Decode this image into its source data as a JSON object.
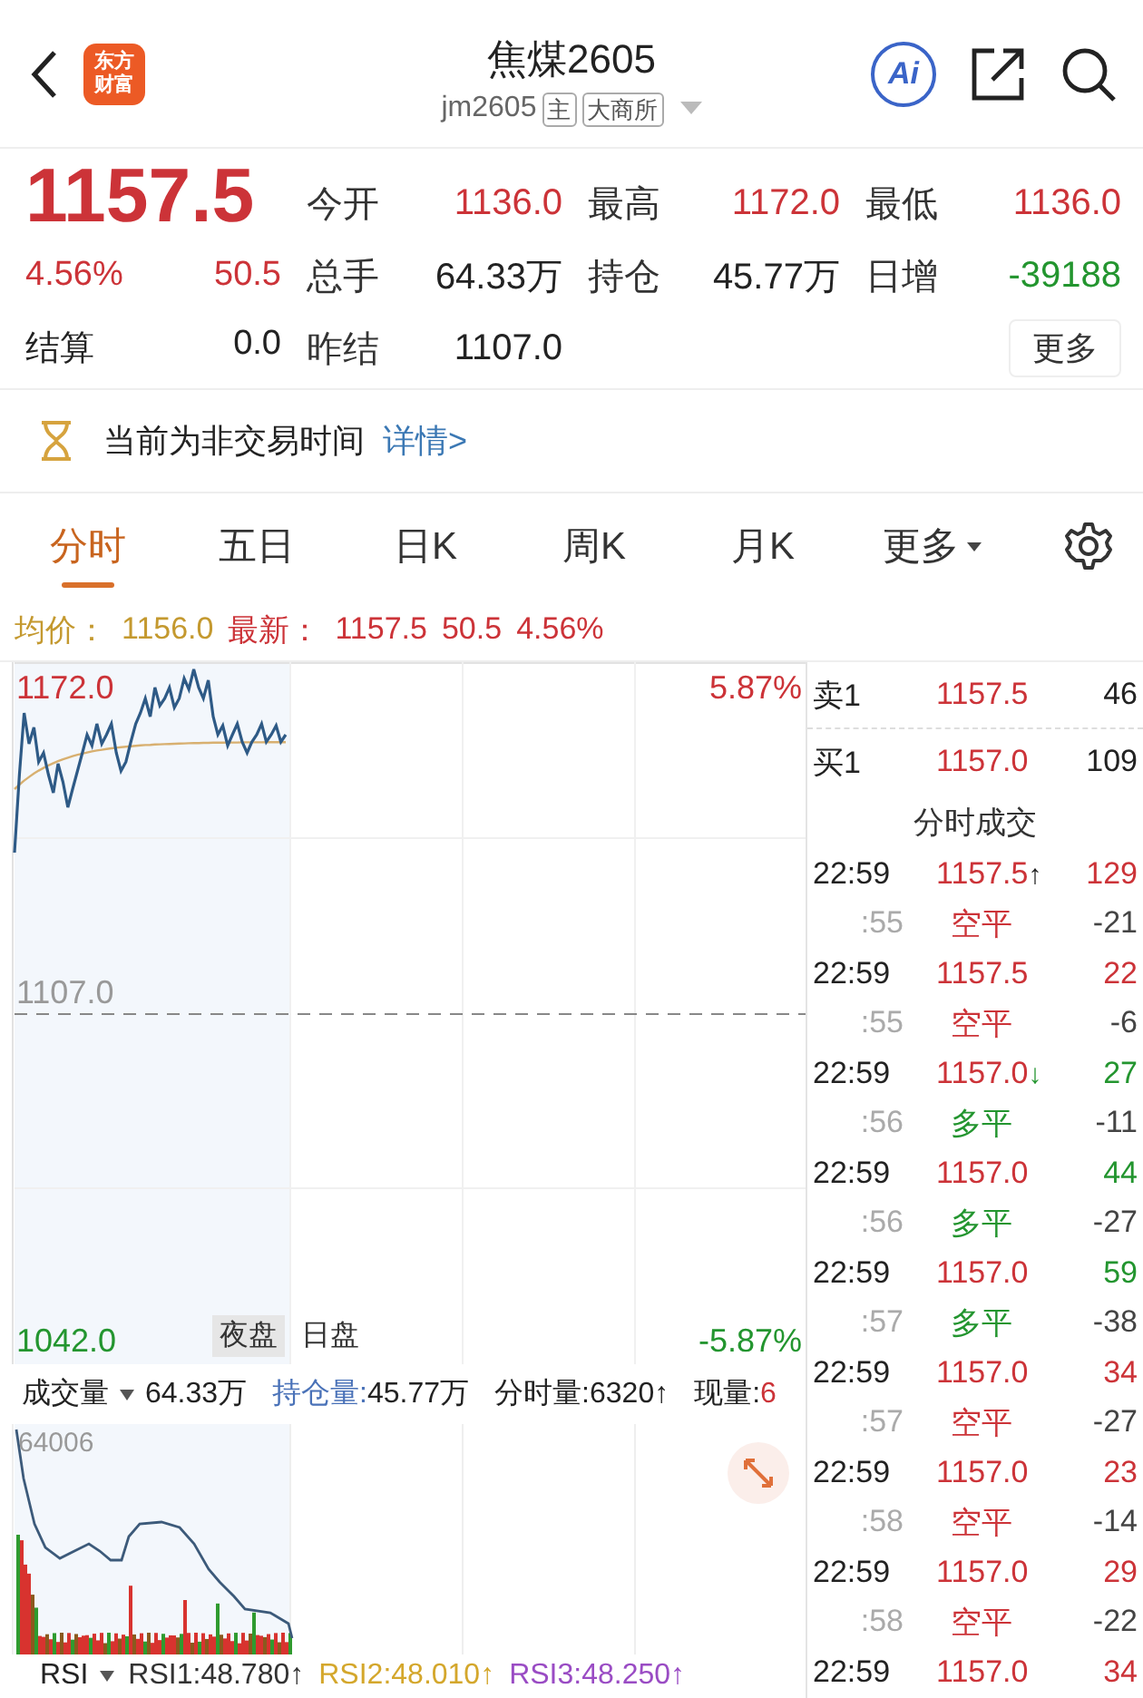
{
  "header": {
    "logo_lines": [
      "东方",
      "财富"
    ],
    "title": "焦煤2605",
    "code": "jm2605",
    "badges": [
      "主",
      "大商所"
    ],
    "ai_label": "Ai"
  },
  "quote": {
    "price": "1157.5",
    "change_percent": "4.56%",
    "change": "50.5",
    "color": "#cc3338",
    "settle_label": "结算",
    "settle_value": "0.0",
    "more_button": "更多",
    "fields": [
      {
        "label": "今开",
        "value": "1136.0",
        "color": "#cc3338"
      },
      {
        "label": "最高",
        "value": "1172.0",
        "color": "#cc3338"
      },
      {
        "label": "最低",
        "value": "1136.0",
        "color": "#cc3338"
      },
      {
        "label": "总手",
        "value": "64.33万",
        "color": "#222222"
      },
      {
        "label": "持仓",
        "value": "45.77万",
        "color": "#222222"
      },
      {
        "label": "日增",
        "value": "-39188",
        "color": "#23952f"
      },
      {
        "label": "昨结",
        "value": "1107.0",
        "color": "#222222"
      }
    ]
  },
  "notice": {
    "text": "当前为非交易时间",
    "link": "详情>"
  },
  "tabs": [
    {
      "label": "分时",
      "selected": true,
      "dropdown": false
    },
    {
      "label": "五日",
      "selected": false,
      "dropdown": false
    },
    {
      "label": "日K",
      "selected": false,
      "dropdown": false
    },
    {
      "label": "周K",
      "selected": false,
      "dropdown": false
    },
    {
      "label": "月K",
      "selected": false,
      "dropdown": false
    },
    {
      "label": "更多",
      "selected": false,
      "dropdown": true
    }
  ],
  "summary": [
    {
      "label": "均价：",
      "value": "1156.0",
      "color": "#c4992f"
    },
    {
      "label": "最新：",
      "value": "1157.5",
      "color": "#cc3338"
    },
    {
      "value": "50.5",
      "color": "#cc3338"
    },
    {
      "value": "4.56%",
      "color": "#cc3338"
    }
  ],
  "price_chart": {
    "top_price": "1172.0",
    "top_percent": "5.87%",
    "base_price": "1107.0",
    "bottom_price": "1042.0",
    "bottom_percent": "-5.87%",
    "sessions": [
      {
        "label": "夜盘",
        "selected": true
      },
      {
        "label": "日盘",
        "selected": false
      }
    ]
  },
  "order_book": [
    {
      "label": "卖1",
      "price": "1157.5",
      "volume": "46"
    },
    {
      "label": "买1",
      "price": "1157.0",
      "volume": "109"
    }
  ],
  "trades_title": "分时成交",
  "trades": [
    {
      "time": "22:59",
      "price": "1157.5",
      "arrow": {
        "text": "↑",
        "color": "#222222"
      },
      "volume": {
        "text": "129",
        "color": "#cc3338"
      },
      "seconds": ":55",
      "action": {
        "text": "空平",
        "color": "#cc3338"
      },
      "change": "-21"
    },
    {
      "time": "22:59",
      "price": "1157.5",
      "volume": {
        "text": "22",
        "color": "#cc3338"
      },
      "seconds": ":55",
      "action": {
        "text": "空平",
        "color": "#cc3338"
      },
      "change": "-6"
    },
    {
      "time": "22:59",
      "price": "1157.0",
      "arrow": {
        "text": "↓",
        "color": "#23952f"
      },
      "volume": {
        "text": "27",
        "color": "#23952f"
      },
      "seconds": ":56",
      "action": {
        "text": "多平",
        "color": "#23952f"
      },
      "change": "-11"
    },
    {
      "time": "22:59",
      "price": "1157.0",
      "volume": {
        "text": "44",
        "color": "#23952f"
      },
      "seconds": ":56",
      "action": {
        "text": "多平",
        "color": "#23952f"
      },
      "change": "-27"
    },
    {
      "time": "22:59",
      "price": "1157.0",
      "volume": {
        "text": "59",
        "color": "#23952f"
      },
      "seconds": ":57",
      "action": {
        "text": "多平",
        "color": "#23952f"
      },
      "change": "-38"
    },
    {
      "time": "22:59",
      "price": "1157.0",
      "volume": {
        "text": "34",
        "color": "#cc3338"
      },
      "seconds": ":57",
      "action": {
        "text": "空平",
        "color": "#cc3338"
      },
      "change": "-27"
    },
    {
      "time": "22:59",
      "price": "1157.0",
      "volume": {
        "text": "23",
        "color": "#cc3338"
      },
      "seconds": ":58",
      "action": {
        "text": "空平",
        "color": "#cc3338"
      },
      "change": "-14"
    },
    {
      "time": "22:59",
      "price": "1157.0",
      "volume": {
        "text": "29",
        "color": "#cc3338"
      },
      "seconds": ":58",
      "action": {
        "text": "空平",
        "color": "#cc3338"
      },
      "change": "-22"
    },
    {
      "time": "22:59",
      "price": "1157.0",
      "volume": {
        "text": "34",
        "color": "#cc3338"
      }
    }
  ],
  "volume": {
    "selector": "成交量",
    "total": "64.33万",
    "max_label": "64006",
    "stats": [
      {
        "label": {
          "text": "持仓量:",
          "color": "#4a72b8"
        },
        "value": {
          "text": "45.77万",
          "color": "#222222"
        }
      },
      {
        "label": {
          "text": "分时量:",
          "color": "#222222"
        },
        "value": {
          "text": "6320↑",
          "color": "#222222"
        }
      },
      {
        "label": {
          "text": "现量:",
          "color": "#222222"
        },
        "value": {
          "text": "6",
          "color": "#cc3338"
        }
      }
    ]
  },
  "indicator": {
    "selector": "RSI",
    "values": [
      {
        "text": "RSI1:48.780↑",
        "color": "#333333"
      },
      {
        "text": "RSI2:48.010↑",
        "color": "#d4a72c"
      },
      {
        "text": "RSI3:48.250↑",
        "color": "#9a4cc4"
      }
    ]
  }
}
